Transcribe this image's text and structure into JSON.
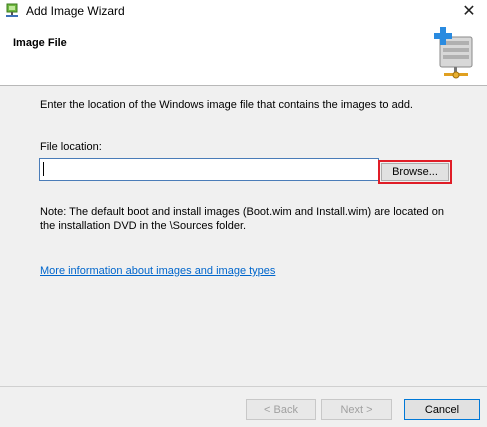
{
  "window": {
    "title": "Add Image Wizard",
    "close_glyph": "✕",
    "icon": "wizard-network-icon"
  },
  "header": {
    "title": "Image File",
    "icon": "add-image-server-icon"
  },
  "content": {
    "instruction": "Enter the location of the Windows image file that contains the images to add.",
    "file_location_label": "File location:",
    "file_location_value": "",
    "browse_label": "Browse...",
    "note": "Note: The default boot and install images (Boot.wim and Install.wim) are located on the installation DVD in the \\Sources folder.",
    "more_info_link": "More information about images and image types"
  },
  "footer": {
    "back_label": "< Back",
    "next_label": "Next >",
    "cancel_label": "Cancel"
  },
  "colors": {
    "highlight_border": "#e01d27",
    "link": "#0066cc",
    "input_border": "#4a7cb8",
    "cancel_focus_border": "#0078d7"
  }
}
